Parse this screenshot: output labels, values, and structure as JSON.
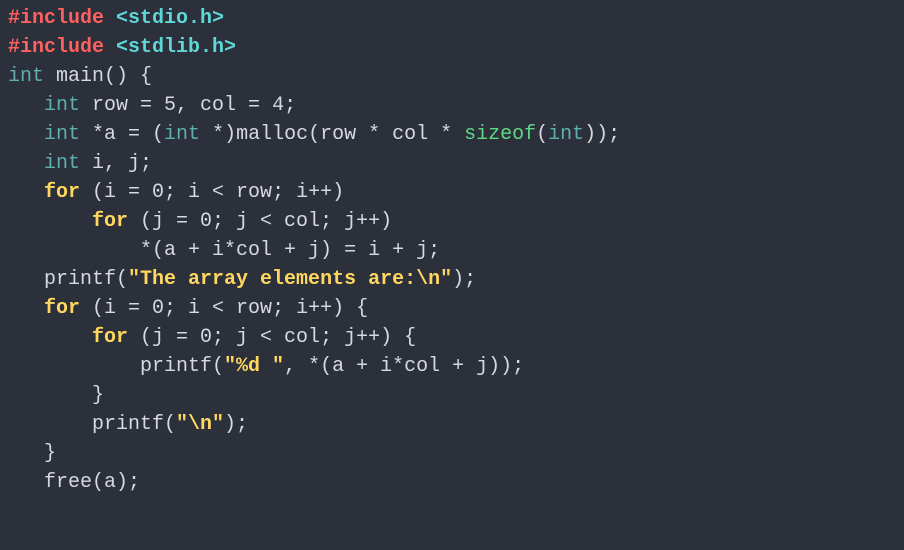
{
  "code": {
    "line1": {
      "include": "#include",
      "header": " <stdio.h>"
    },
    "line2": {
      "include": "#include",
      "header": " <stdlib.h>"
    },
    "line3": {
      "type": "int",
      "rest": " main() {"
    },
    "line4": {
      "indent": "   ",
      "type": "int",
      "rest": " row = 5, col = 4;"
    },
    "line5": {
      "indent": "   ",
      "type1": "int",
      "mid1": " *a = (",
      "type2": "int",
      "mid2": " *)malloc(row * col * ",
      "sizeof": "sizeof",
      "mid3": "(",
      "type3": "int",
      "rest": "));"
    },
    "line6": {
      "indent": "   ",
      "type": "int",
      "rest": " i, j;"
    },
    "line7": {
      "indent": "   ",
      "for": "for",
      "rest": " (i = 0; i < row; i++)"
    },
    "line8": {
      "indent": "       ",
      "for": "for",
      "rest": " (j = 0; j < col; j++)"
    },
    "line9": {
      "indent": "           ",
      "rest": "*(a + i*col + j) = i + j;"
    },
    "line10": {
      "indent": "   ",
      "func": "printf(",
      "string": "\"The array elements are:\\n\"",
      "rest": ");"
    },
    "line11": {
      "indent": "   ",
      "for": "for",
      "rest": " (i = 0; i < row; i++) {"
    },
    "line12": {
      "indent": "       ",
      "for": "for",
      "rest": " (j = 0; j < col; j++) {"
    },
    "line13": {
      "indent": "           ",
      "func": "printf(",
      "string": "\"%d \"",
      "rest": ", *(a + i*col + j));"
    },
    "line14": {
      "indent": "       ",
      "rest": "}"
    },
    "line15": {
      "indent": "       ",
      "func": "printf(",
      "string": "\"\\n\"",
      "rest": ");"
    },
    "line16": {
      "indent": "   ",
      "rest": "}"
    },
    "line17": {
      "indent": "   ",
      "rest": "free(a);"
    }
  }
}
